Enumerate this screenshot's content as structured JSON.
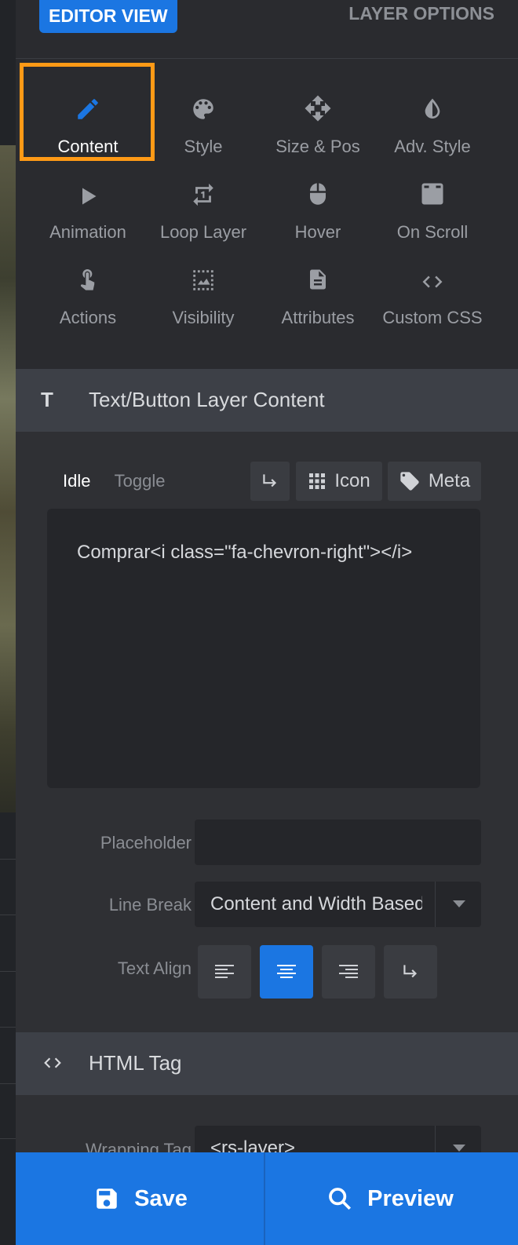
{
  "header": {
    "editor_view": "EDITOR VIEW",
    "layer_options": "LAYER OPTIONS"
  },
  "options": [
    {
      "label": "Content",
      "icon": "pencil-icon",
      "active": true
    },
    {
      "label": "Style",
      "icon": "palette-icon"
    },
    {
      "label": "Size & Pos",
      "icon": "move-arrows-icon"
    },
    {
      "label": "Adv. Style",
      "icon": "contrast-drop-icon"
    },
    {
      "label": "Animation",
      "icon": "play-icon"
    },
    {
      "label": "Loop Layer",
      "icon": "repeat-one-icon"
    },
    {
      "label": "Hover",
      "icon": "mouse-icon"
    },
    {
      "label": "On Scroll",
      "icon": "download-box-icon"
    },
    {
      "label": "Actions",
      "icon": "touch-hand-icon"
    },
    {
      "label": "Visibility",
      "icon": "dashed-image-icon"
    },
    {
      "label": "Attributes",
      "icon": "document-icon"
    },
    {
      "label": "Custom CSS",
      "icon": "code-brackets-icon"
    }
  ],
  "content_section": {
    "title": "Text/Button Layer Content",
    "tabs": {
      "idle": "Idle",
      "toggle": "Toggle"
    },
    "toolbar": {
      "icon": "Icon",
      "meta": "Meta"
    },
    "editor_text": "Comprar<i class=\"fa-chevron-right\"></i>",
    "placeholder_label": "Placeholder",
    "placeholder_value": "",
    "line_break_label": "Line Break",
    "line_break_value": "Content and Width Based",
    "text_align_label": "Text Align",
    "text_align_selected": "center"
  },
  "html_tag_section": {
    "title": "HTML Tag",
    "wrapping_tag_label": "Wrapping Tag",
    "wrapping_tag_value": "<rs-layer>"
  },
  "footer": {
    "save": "Save",
    "preview": "Preview"
  },
  "colors": {
    "accent": "#1b76e2",
    "highlight": "#ff9a16",
    "panel": "#2f3034"
  }
}
